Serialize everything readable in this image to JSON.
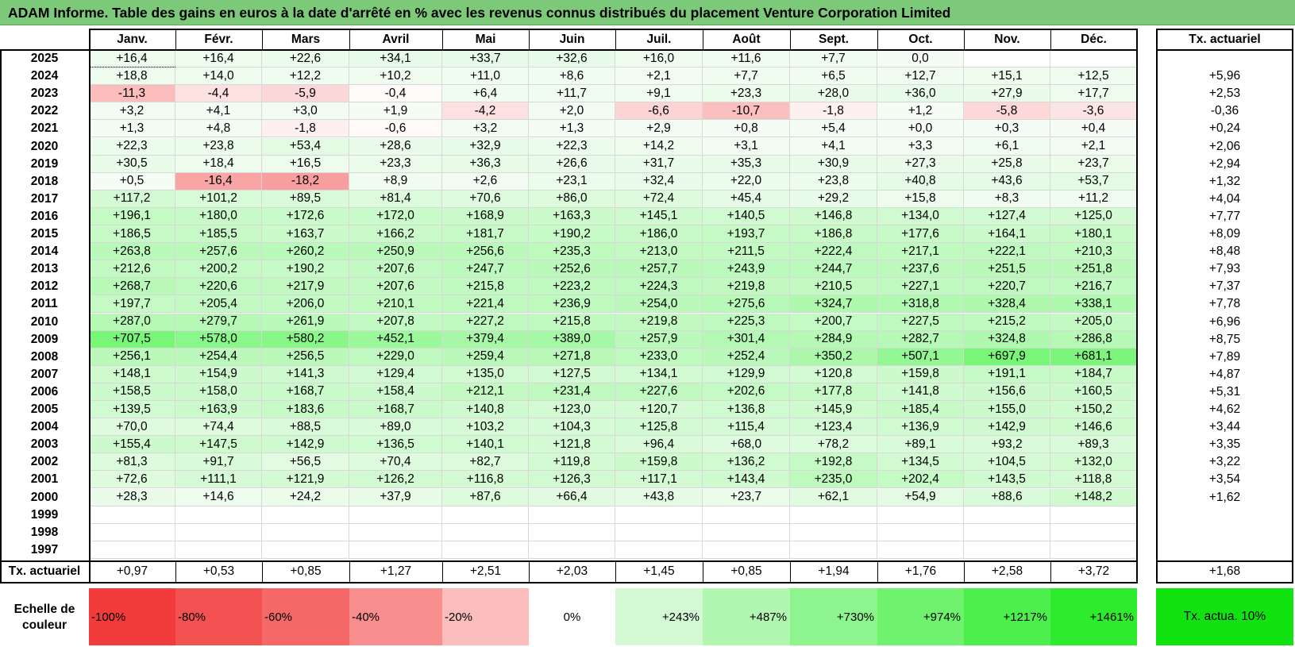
{
  "title": "ADAM Informe. Table des gains en euros à la date d'arrêté en % avec les revenus connus distribués du placement Venture Corporation Limited",
  "header": {
    "months": [
      "Janv.",
      "Févr.",
      "Mars",
      "Avril",
      "Mai",
      "Juin",
      "Juil.",
      "Août",
      "Sept.",
      "Oct.",
      "Nov.",
      "Déc."
    ],
    "rate_label": "Tx. actuariel"
  },
  "chart_data": {
    "type": "table",
    "columns": [
      "Janv.",
      "Févr.",
      "Mars",
      "Avril",
      "Mai",
      "Juin",
      "Juil.",
      "Août",
      "Sept.",
      "Oct.",
      "Nov.",
      "Déc.",
      "Tx. actuariel"
    ],
    "rows": [
      {
        "year": "2025",
        "values": [
          "+16,4",
          "+16,4",
          "+22,6",
          "+34,1",
          "+33,7",
          "+32,6",
          "+16,0",
          "+11,6",
          "+7,7",
          "0,0",
          "",
          ""
        ],
        "rate": ""
      },
      {
        "year": "2024",
        "values": [
          "+18,8",
          "+14,0",
          "+12,2",
          "+10,2",
          "+11,0",
          "+8,6",
          "+2,1",
          "+7,7",
          "+6,5",
          "+12,7",
          "+15,1",
          "+12,5"
        ],
        "rate": "+5,96"
      },
      {
        "year": "2023",
        "values": [
          "-11,3",
          "-4,4",
          "-5,9",
          "-0,4",
          "+6,4",
          "+11,7",
          "+9,1",
          "+23,3",
          "+28,0",
          "+36,0",
          "+27,9",
          "+17,7"
        ],
        "rate": "+2,53"
      },
      {
        "year": "2022",
        "values": [
          "+3,2",
          "+4,1",
          "+3,0",
          "+1,9",
          "-4,2",
          "+2,0",
          "-6,6",
          "-10,7",
          "-1,8",
          "+1,2",
          "-5,8",
          "-3,6"
        ],
        "rate": "-0,36"
      },
      {
        "year": "2021",
        "values": [
          "+1,3",
          "+4,8",
          "-1,8",
          "-0,6",
          "+3,2",
          "+1,3",
          "+2,9",
          "+0,8",
          "+5,4",
          "+0,0",
          "+0,3",
          "+0,4"
        ],
        "rate": "+0,24"
      },
      {
        "year": "2020",
        "values": [
          "+22,3",
          "+23,8",
          "+53,4",
          "+28,6",
          "+32,9",
          "+22,3",
          "+14,2",
          "+3,1",
          "+4,1",
          "+3,3",
          "+6,1",
          "+2,1"
        ],
        "rate": "+2,06"
      },
      {
        "year": "2019",
        "values": [
          "+30,5",
          "+18,4",
          "+16,5",
          "+23,3",
          "+36,3",
          "+26,6",
          "+31,7",
          "+35,3",
          "+30,9",
          "+27,3",
          "+25,8",
          "+23,7"
        ],
        "rate": "+2,94"
      },
      {
        "year": "2018",
        "values": [
          "+0,5",
          "-16,4",
          "-18,2",
          "+8,9",
          "+2,6",
          "+23,1",
          "+32,4",
          "+22,0",
          "+23,8",
          "+40,8",
          "+43,6",
          "+53,7"
        ],
        "rate": "+1,32"
      },
      {
        "year": "2017",
        "values": [
          "+117,2",
          "+101,2",
          "+89,5",
          "+81,4",
          "+70,6",
          "+86,0",
          "+72,4",
          "+45,4",
          "+29,2",
          "+15,8",
          "+8,3",
          "+11,2"
        ],
        "rate": "+4,04"
      },
      {
        "year": "2016",
        "values": [
          "+196,1",
          "+180,0",
          "+172,6",
          "+172,0",
          "+168,9",
          "+163,3",
          "+145,1",
          "+140,5",
          "+146,8",
          "+134,0",
          "+127,4",
          "+125,0"
        ],
        "rate": "+7,77"
      },
      {
        "year": "2015",
        "values": [
          "+186,5",
          "+185,5",
          "+163,7",
          "+166,2",
          "+181,7",
          "+190,2",
          "+186,0",
          "+193,7",
          "+186,8",
          "+177,6",
          "+164,1",
          "+180,1"
        ],
        "rate": "+8,09"
      },
      {
        "year": "2014",
        "values": [
          "+263,8",
          "+257,6",
          "+260,2",
          "+250,9",
          "+256,6",
          "+235,3",
          "+213,0",
          "+211,5",
          "+222,4",
          "+217,1",
          "+222,1",
          "+210,3"
        ],
        "rate": "+8,48"
      },
      {
        "year": "2013",
        "values": [
          "+212,6",
          "+200,2",
          "+190,2",
          "+207,6",
          "+247,7",
          "+252,6",
          "+257,7",
          "+243,9",
          "+244,7",
          "+237,6",
          "+251,5",
          "+251,8"
        ],
        "rate": "+7,93"
      },
      {
        "year": "2012",
        "values": [
          "+268,7",
          "+220,6",
          "+217,9",
          "+207,6",
          "+215,8",
          "+223,2",
          "+224,3",
          "+219,8",
          "+210,5",
          "+227,1",
          "+220,7",
          "+216,7"
        ],
        "rate": "+7,37"
      },
      {
        "year": "2011",
        "values": [
          "+197,7",
          "+205,4",
          "+206,0",
          "+210,1",
          "+221,4",
          "+236,9",
          "+254,0",
          "+275,6",
          "+324,7",
          "+318,8",
          "+328,4",
          "+338,1"
        ],
        "rate": "+7,78"
      },
      {
        "year": "2010",
        "values": [
          "+287,0",
          "+279,7",
          "+261,9",
          "+207,8",
          "+227,2",
          "+215,8",
          "+219,8",
          "+225,3",
          "+200,7",
          "+227,5",
          "+215,2",
          "+205,0"
        ],
        "rate": "+6,96"
      },
      {
        "year": "2009",
        "values": [
          "+707,5",
          "+578,0",
          "+580,2",
          "+452,1",
          "+379,4",
          "+389,0",
          "+257,9",
          "+301,4",
          "+284,9",
          "+282,7",
          "+324,8",
          "+286,8"
        ],
        "rate": "+8,75"
      },
      {
        "year": "2008",
        "values": [
          "+256,1",
          "+254,4",
          "+256,5",
          "+229,0",
          "+259,4",
          "+271,8",
          "+233,0",
          "+252,4",
          "+350,2",
          "+507,1",
          "+697,9",
          "+681,1"
        ],
        "rate": "+7,89"
      },
      {
        "year": "2007",
        "values": [
          "+148,1",
          "+154,9",
          "+141,3",
          "+129,4",
          "+135,0",
          "+127,5",
          "+134,1",
          "+129,9",
          "+120,8",
          "+159,8",
          "+191,1",
          "+184,7"
        ],
        "rate": "+4,87"
      },
      {
        "year": "2006",
        "values": [
          "+158,5",
          "+158,0",
          "+168,7",
          "+158,4",
          "+212,1",
          "+231,4",
          "+227,6",
          "+202,6",
          "+177,8",
          "+141,8",
          "+156,6",
          "+160,5"
        ],
        "rate": "+5,31"
      },
      {
        "year": "2005",
        "values": [
          "+139,5",
          "+163,9",
          "+183,6",
          "+168,7",
          "+140,8",
          "+123,0",
          "+120,7",
          "+136,8",
          "+145,9",
          "+185,4",
          "+155,0",
          "+150,2"
        ],
        "rate": "+4,62"
      },
      {
        "year": "2004",
        "values": [
          "+70,0",
          "+74,4",
          "+88,5",
          "+89,0",
          "+103,2",
          "+104,3",
          "+125,8",
          "+115,4",
          "+123,4",
          "+136,9",
          "+142,9",
          "+146,6"
        ],
        "rate": "+3,44"
      },
      {
        "year": "2003",
        "values": [
          "+155,4",
          "+147,5",
          "+142,9",
          "+136,5",
          "+140,1",
          "+121,8",
          "+96,4",
          "+68,0",
          "+78,2",
          "+89,1",
          "+93,2",
          "+89,3"
        ],
        "rate": "+3,35"
      },
      {
        "year": "2002",
        "values": [
          "+81,3",
          "+91,7",
          "+56,5",
          "+70,4",
          "+82,7",
          "+119,8",
          "+159,8",
          "+136,2",
          "+192,8",
          "+134,5",
          "+104,5",
          "+132,0"
        ],
        "rate": "+3,22"
      },
      {
        "year": "2001",
        "values": [
          "+72,6",
          "+111,1",
          "+121,9",
          "+126,2",
          "+116,8",
          "+126,3",
          "+117,1",
          "+143,4",
          "+235,0",
          "+202,4",
          "+143,5",
          "+118,8"
        ],
        "rate": "+3,54"
      },
      {
        "year": "2000",
        "values": [
          "+28,3",
          "+14,6",
          "+24,2",
          "+37,9",
          "+87,6",
          "+66,4",
          "+43,8",
          "+23,7",
          "+62,1",
          "+54,9",
          "+88,6",
          "+148,2"
        ],
        "rate": "+1,62"
      },
      {
        "year": "1999",
        "values": [
          "",
          "",
          "",
          "",
          "",
          "",
          "",
          "",
          "",
          "",
          "",
          ""
        ],
        "rate": ""
      },
      {
        "year": "1998",
        "values": [
          "",
          "",
          "",
          "",
          "",
          "",
          "",
          "",
          "",
          "",
          "",
          ""
        ],
        "rate": ""
      },
      {
        "year": "1997",
        "values": [
          "",
          "",
          "",
          "",
          "",
          "",
          "",
          "",
          "",
          "",
          "",
          ""
        ],
        "rate": ""
      }
    ],
    "footer": {
      "label": "Tx. actuariel",
      "values": [
        "+0,97",
        "+0,53",
        "+0,85",
        "+1,27",
        "+2,51",
        "+2,03",
        "+1,45",
        "+0,85",
        "+1,94",
        "+1,76",
        "+2,58",
        "+3,72"
      ],
      "rate": "+1,68"
    },
    "color_scale": {
      "label": "Echelle de couleur",
      "stops": [
        "-100%",
        "-80%",
        "-60%",
        "-40%",
        "-20%",
        "0%",
        "+243%",
        "+487%",
        "+730%",
        "+974%",
        "+1217%",
        "+1461%"
      ],
      "colors": [
        "#f23c3c",
        "#f35252",
        "#f56868",
        "#f88e8e",
        "#fbbcbc",
        "#ffffff",
        "#d3f8d3",
        "#b1f6b1",
        "#8ef48e",
        "#6ff36f",
        "#4cef4c",
        "#2eeb2e"
      ],
      "rate_label": "Tx. actua. 10%",
      "rate_color": "#11e311"
    },
    "max_positive_reference": 1461,
    "min_negative_reference": -100
  }
}
